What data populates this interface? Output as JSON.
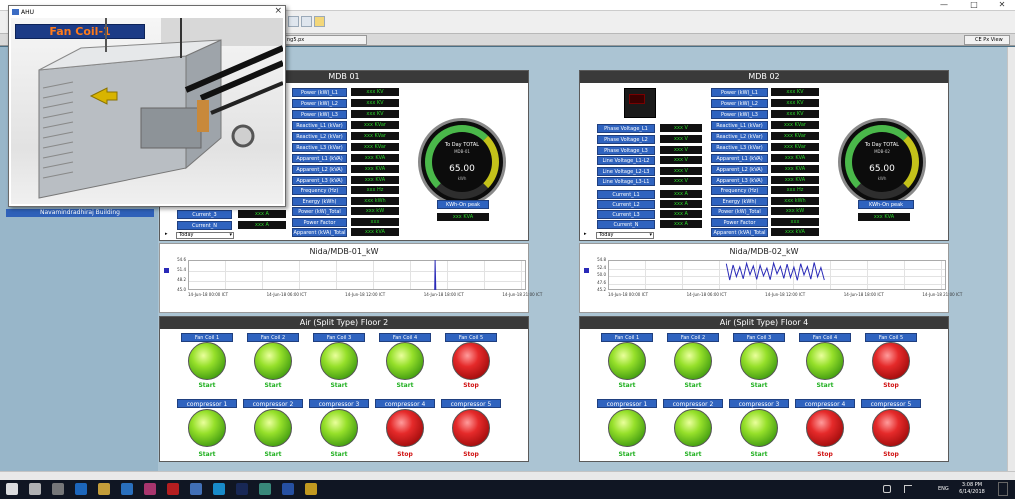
{
  "window": {
    "title": "",
    "min": "—",
    "max": "□",
    "close": "✕"
  },
  "tab": {
    "active": "ng5.px",
    "right": "CE Px View"
  },
  "sidebar": {
    "building": "Navamindradhiraj Building"
  },
  "popup": {
    "title": "AHU",
    "close": "×",
    "fan_coil_title": "Fan Coil-1"
  },
  "mdb01": {
    "title": "MDB 01",
    "power_labels": [
      "Power (kW)_L1",
      "Power (kW)_L2",
      "Power (kW)_L3"
    ],
    "power_values": [
      "xxx KV",
      "xxx KV",
      "xxx KV"
    ],
    "reactive_labels": [
      "Reactive_L1 (kVar)",
      "Reactive_L2 (kVar)",
      "Reactive_L3 (kVar)"
    ],
    "reactive_values": [
      "xxx KVar",
      "xxx KVar",
      "xxx KVar"
    ],
    "apparent_labels": [
      "Apparent_L1 (kVA)",
      "Apparent_L2 (kVA)",
      "Apparent_L3 (kVA)"
    ],
    "apparent_values": [
      "xxx KVA",
      "xxx KVA",
      "xxx KVA"
    ],
    "other_labels": [
      "Frequency (Hz)",
      "Energy (kWh)",
      "Power (kW)_Total",
      "Power Factor",
      "Apparent (kVA)_Total"
    ],
    "other_values": [
      "xxx Hz",
      "xxx kWh",
      "xxx kW",
      "xxx",
      "xxx kVA"
    ],
    "current_labels": [
      "Current_3",
      "Current_N"
    ],
    "current_values": [
      "xxx A",
      "xxx A"
    ],
    "select": "Today",
    "gauge": {
      "line1": "To Day TOTAL",
      "line2": "MDB-01",
      "value": "65.00",
      "unit": "kWh"
    },
    "kwh_peak_label": "KWh-On peak",
    "kwh_peak_value": "xxx KVA"
  },
  "mdb02": {
    "title": "MDB 02",
    "phase_labels": [
      "Phase Voltage_L1",
      "Phase Voltage_L2",
      "Phase Voltage_L3"
    ],
    "phase_values": [
      "xxx V",
      "xxx V",
      "xxx V"
    ],
    "line_labels": [
      "Line Voltage_L1-L2",
      "Line Voltage_L2-L3",
      "Line Voltage_L3-L1"
    ],
    "line_values": [
      "xxx V",
      "xxx V",
      "xxx V"
    ],
    "current_labels": [
      "Current_L1",
      "Current_L2",
      "Current_L3",
      "Current_N"
    ],
    "current_values": [
      "xxx A",
      "xxx A",
      "xxx A",
      "xxx A"
    ],
    "power_labels": [
      "Power (kW)_L1",
      "Power (kW)_L2",
      "Power (kW)_L3"
    ],
    "power_values": [
      "xxx KV",
      "xxx KV",
      "xxx KV"
    ],
    "reactive_labels": [
      "Reactive_L1 (kVar)",
      "Reactive_L2 (kVar)",
      "Reactive_L3 (kVar)"
    ],
    "reactive_values": [
      "xxx KVar",
      "xxx KVar",
      "xxx KVar"
    ],
    "apparent_labels": [
      "Apparent_L1 (kVA)",
      "Apparent_L2 (kVA)",
      "Apparent_L3 (kVA)"
    ],
    "apparent_values": [
      "xxx KVA",
      "xxx KVA",
      "xxx KVA"
    ],
    "other_labels": [
      "Frequency (Hz)",
      "Energy (kWh)",
      "Power (kW)_Total",
      "Power Factor",
      "Apparent (kVA)_Total"
    ],
    "other_values": [
      "xxx Hz",
      "xxx kWh",
      "xxx kW",
      "xxx",
      "xxx kVA"
    ],
    "select": "Today",
    "gauge": {
      "line1": "To Day TOTAL",
      "line2": "MDB-02",
      "value": "65.00",
      "unit": "kWh"
    },
    "kwh_peak_label": "KWh-On peak",
    "kwh_peak_value": "xxx KVA"
  },
  "chart_data": [
    {
      "type": "line",
      "title": "Nida/MDB-01_kW",
      "yticks": [
        "54.6",
        "51.4",
        "48.2",
        "45.0"
      ],
      "xticks": [
        "14-Jun-18 00:00 ICT",
        "14-Jun-18 06:00 ICT",
        "14-Jun-18 12:00 ICT",
        "14-Jun-18 18:00 ICT",
        "14-Jun-18 21:00 ICT"
      ],
      "ylim": [
        45.0,
        54.6
      ],
      "series": [
        {
          "values": [
            [
              0.73,
              45.0
            ],
            [
              0.731,
              54.6
            ],
            [
              0.733,
              45.0
            ]
          ]
        }
      ]
    },
    {
      "type": "line",
      "title": "Nida/MDB-02_kW",
      "yticks": [
        "54.8",
        "52.4",
        "50.0",
        "47.6",
        "45.2"
      ],
      "xticks": [
        "14-Jun-18 00:00 ICT",
        "14-Jun-18 06:00 ICT",
        "14-Jun-18 12:00 ICT",
        "14-Jun-18 18:00 ICT",
        "14-Jun-18 21:00 ICT"
      ],
      "ylim": [
        45.2,
        54.8
      ],
      "series": [
        {
          "values": [
            [
              0.35,
              53.6
            ],
            [
              0.36,
              48.4
            ],
            [
              0.37,
              53.2
            ],
            [
              0.38,
              49.5
            ],
            [
              0.39,
              52.6
            ],
            [
              0.4,
              48.8
            ],
            [
              0.41,
              53.7
            ],
            [
              0.42,
              50.1
            ],
            [
              0.43,
              52.9
            ],
            [
              0.44,
              48.6
            ],
            [
              0.45,
              53.1
            ],
            [
              0.46,
              49.7
            ],
            [
              0.47,
              52.2
            ],
            [
              0.48,
              48.5
            ],
            [
              0.49,
              53.8
            ],
            [
              0.5,
              50.4
            ],
            [
              0.51,
              52.8
            ],
            [
              0.52,
              48.9
            ],
            [
              0.53,
              53.5
            ],
            [
              0.54,
              49.2
            ],
            [
              0.55,
              52.5
            ],
            [
              0.56,
              48.3
            ],
            [
              0.57,
              53.6
            ],
            [
              0.58,
              50.0
            ],
            [
              0.59,
              52.7
            ],
            [
              0.6,
              48.7
            ],
            [
              0.61,
              54.0
            ],
            [
              0.62,
              49.4
            ],
            [
              0.63,
              52.4
            ],
            [
              0.64,
              48.4
            ]
          ]
        }
      ]
    }
  ],
  "floor2": {
    "title": "Air (Split Type) Floor 2",
    "fan_coils": [
      "Fan Coil 1",
      "Fan Coil 2",
      "Fan Coil 3",
      "Fan Coil 4",
      "Fan Coil 5"
    ],
    "fan_states": [
      "Start",
      "Start",
      "Start",
      "Start",
      "Stop"
    ],
    "compressors": [
      "compressor 1",
      "compressor 2",
      "compressor 3",
      "compressor 4",
      "compressor 5"
    ],
    "comp_states": [
      "Start",
      "Start",
      "Start",
      "Stop",
      "Stop"
    ]
  },
  "floor4": {
    "title": "Air (Split Type) Floor 4",
    "fan_coils": [
      "Fan Coil 1",
      "Fan Coil 2",
      "Fan Coil 3",
      "Fan Coil 4",
      "Fan Coil 5"
    ],
    "fan_states": [
      "Start",
      "Start",
      "Start",
      "Start",
      "Stop"
    ],
    "compressors": [
      "compressor 1",
      "compressor 2",
      "compressor 3",
      "compressor 4",
      "compressor 5"
    ],
    "comp_states": [
      "Start",
      "Start",
      "Start",
      "Stop",
      "Stop"
    ]
  },
  "colors": {
    "on": "#20b020",
    "off": "#d01010",
    "label_bg": "#2f63bf",
    "header_bg": "#3a3a3a"
  },
  "taskbar": {
    "icons": [
      "windows-icon",
      "search-icon",
      "task-view-icon",
      "edge-icon",
      "explorer-icon",
      "store-icon",
      "app-icon",
      "opera-icon",
      "mail-icon",
      "skype-icon",
      "photoshop-icon",
      "app2-icon",
      "word-icon",
      "chrome-icon"
    ],
    "lang": "ENG",
    "time": "3:08 PM",
    "date": "6/14/2018"
  }
}
